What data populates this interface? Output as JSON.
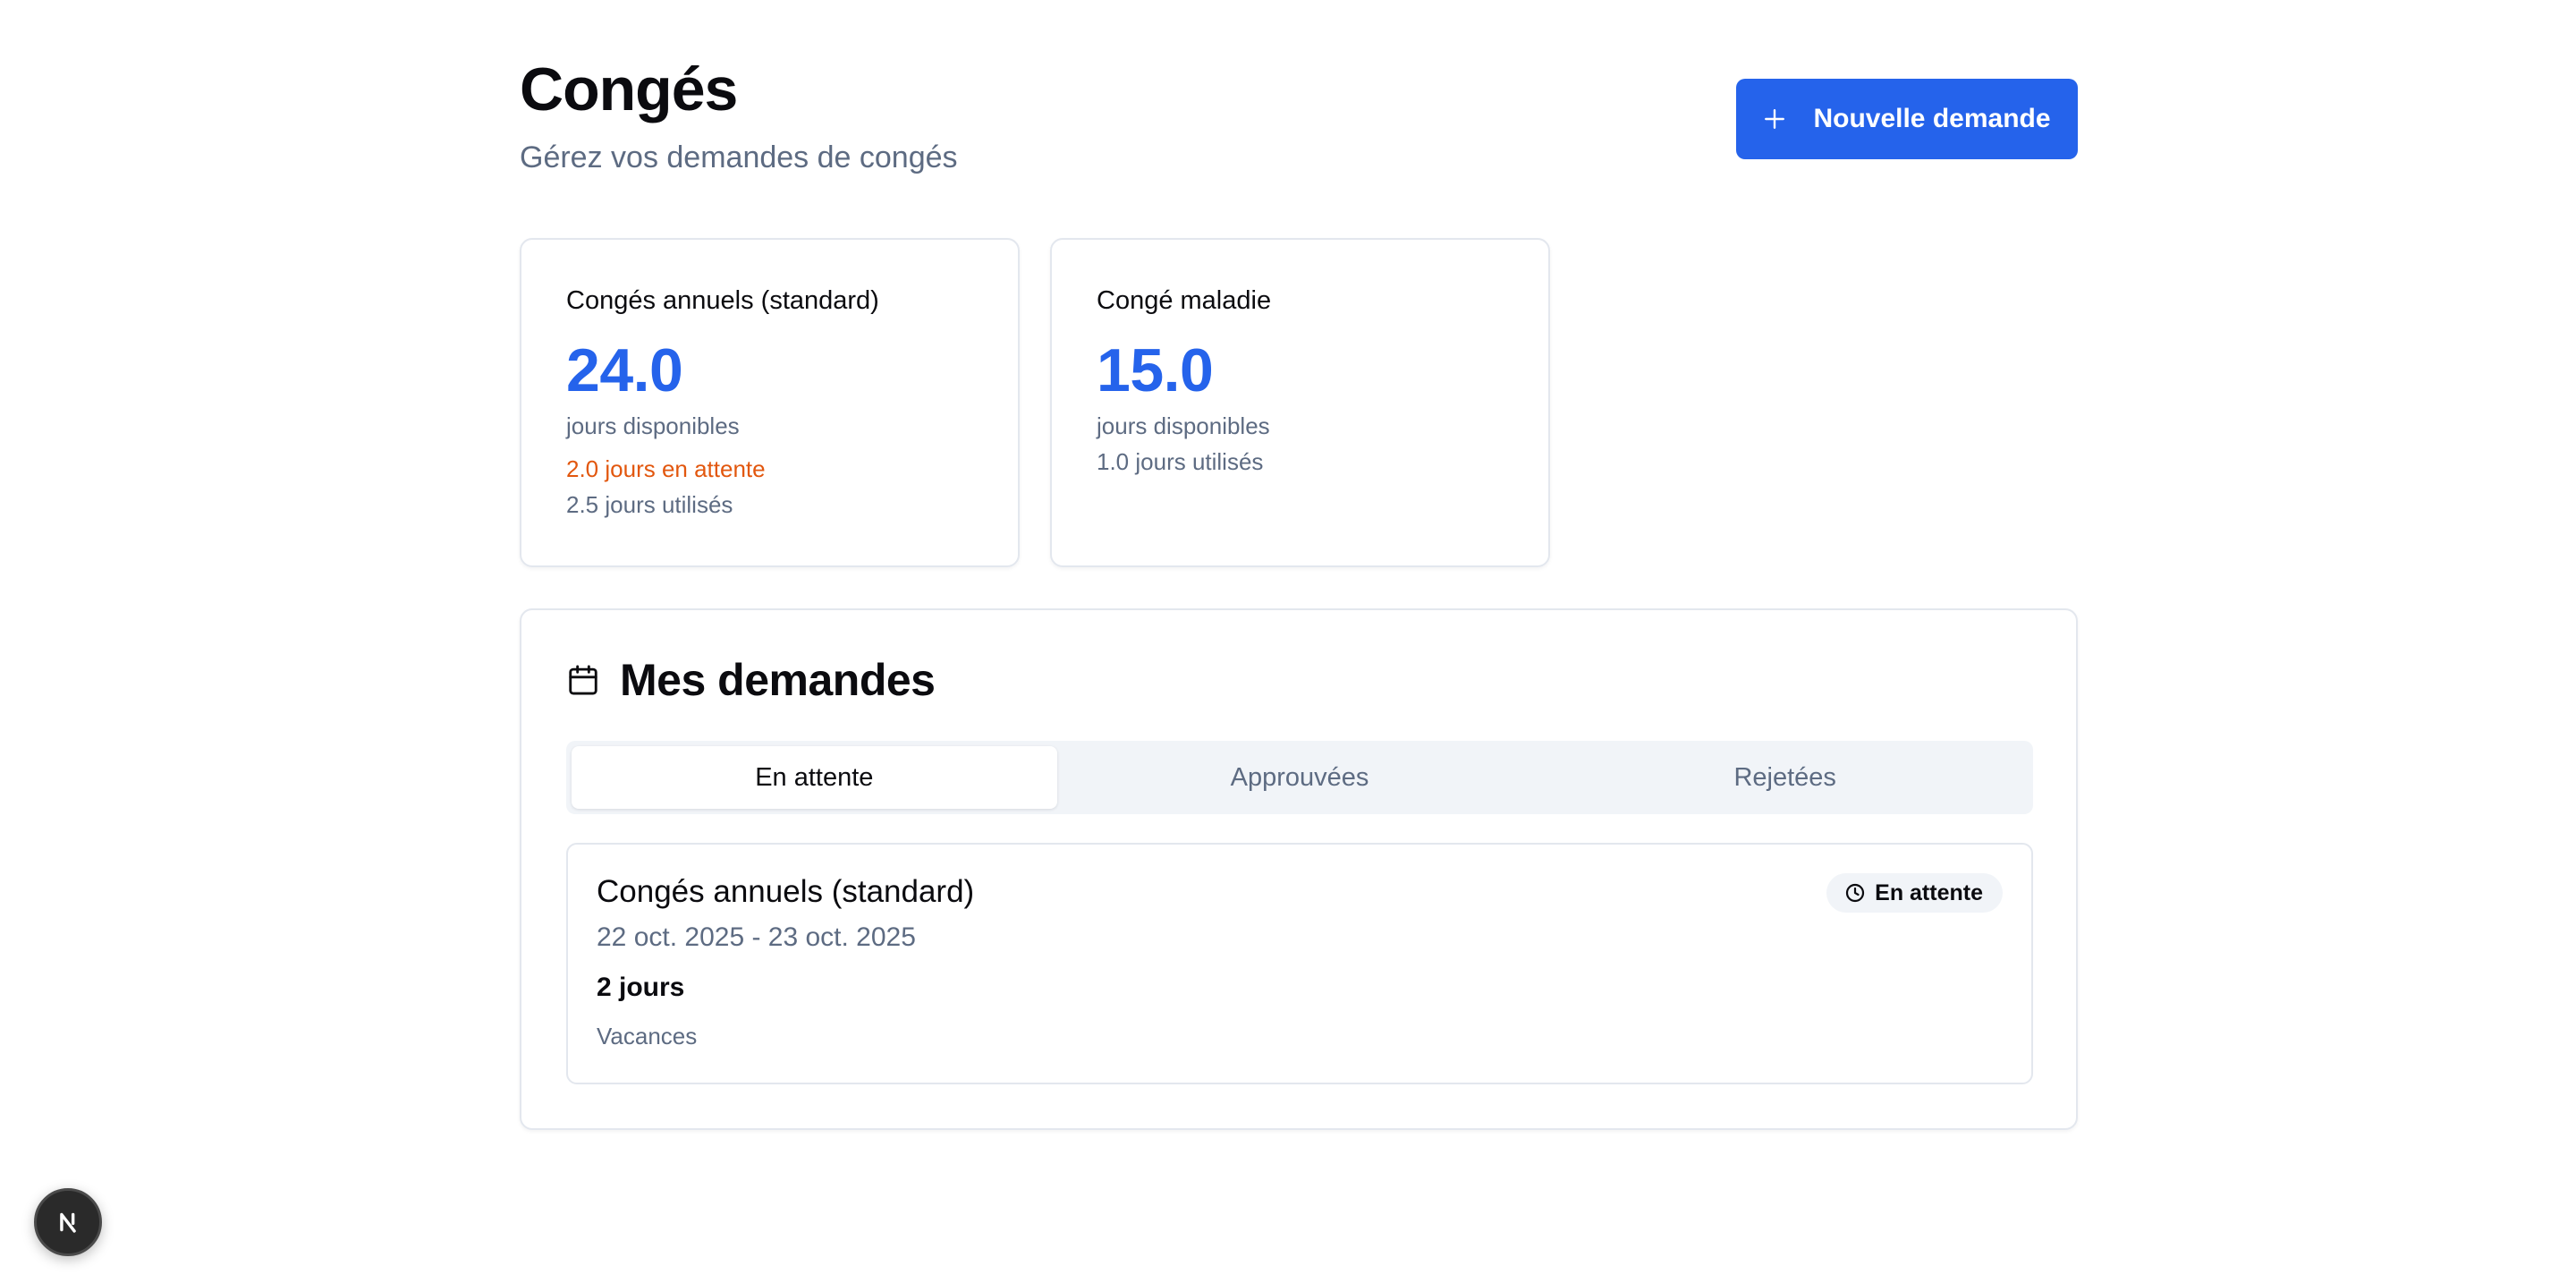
{
  "header": {
    "title": "Congés",
    "subtitle": "Gérez vos demandes de congés",
    "new_request_label": "Nouvelle demande"
  },
  "balances": [
    {
      "title": "Congés annuels (standard)",
      "value": "24.0",
      "available_label": "jours disponibles",
      "pending": "2.0 jours en attente",
      "used": "2.5 jours utilisés"
    },
    {
      "title": "Congé maladie",
      "value": "15.0",
      "available_label": "jours disponibles",
      "used": "1.0 jours utilisés"
    }
  ],
  "requests": {
    "title": "Mes demandes",
    "tabs": [
      {
        "label": "En attente",
        "active": true
      },
      {
        "label": "Approuvées",
        "active": false
      },
      {
        "label": "Rejetées",
        "active": false
      }
    ],
    "items": [
      {
        "type": "Congés annuels (standard)",
        "dates": "22 oct. 2025 - 23 oct. 2025",
        "days": "2 jours",
        "reason": "Vacances",
        "status": "En attente"
      }
    ]
  },
  "icons": {
    "new_request": "plus-icon",
    "requests_title": "calendar-icon",
    "status": "clock-icon",
    "dev_tools": "nextjs-logo-icon"
  },
  "colors": {
    "accent": "#2563eb",
    "pending_text": "#e2570e",
    "muted_text": "#5d6b82",
    "border": "#e3e7ee",
    "tab_background": "#f1f4f8"
  }
}
